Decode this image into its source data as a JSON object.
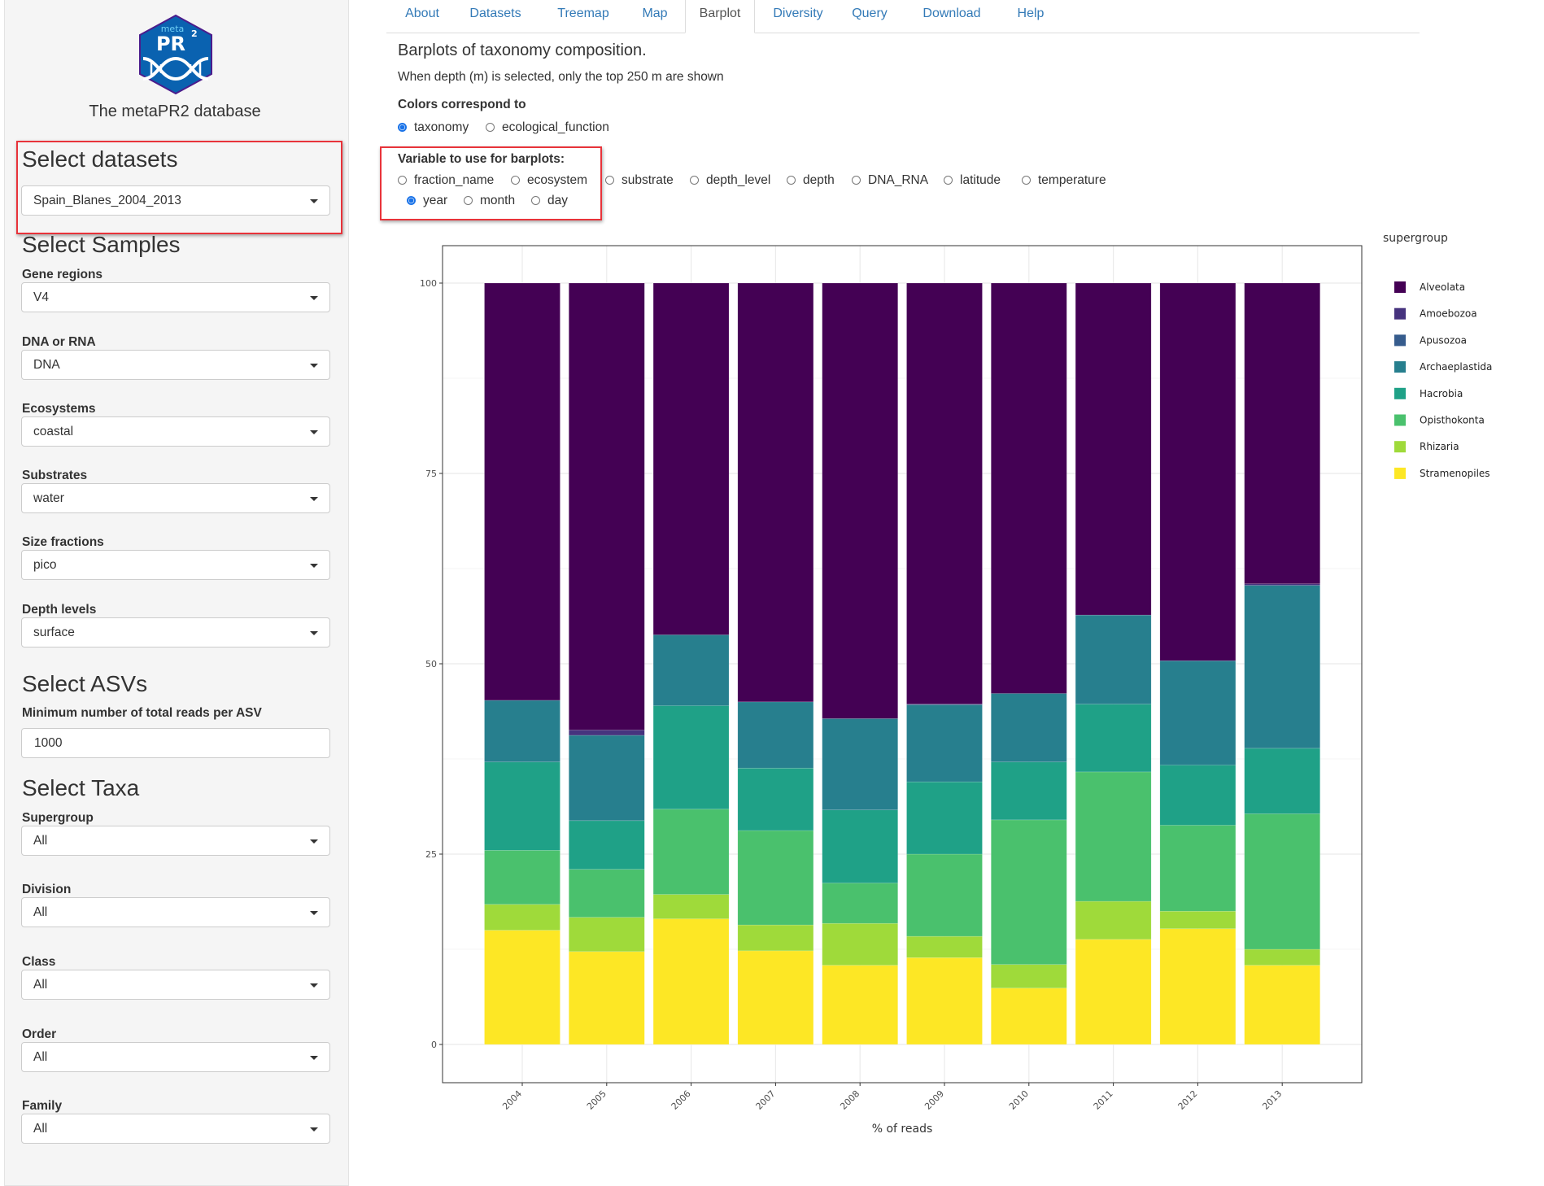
{
  "sidebar": {
    "logo": {
      "top_text": "meta",
      "main_text": "PR",
      "superscript": "2",
      "colors": {
        "fill": "#0A62B0",
        "border": "#4B1C8C",
        "text_top": "#6FD0F5"
      }
    },
    "app_title": "The metaPR2 database",
    "datasets": {
      "heading": "Select datasets",
      "value": "Spain_Blanes_2004_2013"
    },
    "samples": {
      "heading": "Select Samples",
      "fields": [
        {
          "label": "Gene regions",
          "value": "V4"
        },
        {
          "label": "DNA or RNA",
          "value": "DNA"
        },
        {
          "label": "Ecosystems",
          "value": "coastal"
        },
        {
          "label": "Substrates",
          "value": "water"
        },
        {
          "label": "Size fractions",
          "value": "pico"
        },
        {
          "label": "Depth levels",
          "value": "surface"
        }
      ]
    },
    "asvs": {
      "heading": "Select ASVs",
      "label": "Minimum number of total reads per ASV",
      "value": "1000"
    },
    "taxa": {
      "heading": "Select Taxa",
      "fields": [
        {
          "label": "Supergroup",
          "value": "All"
        },
        {
          "label": "Division",
          "value": "All"
        },
        {
          "label": "Class",
          "value": "All"
        },
        {
          "label": "Order",
          "value": "All"
        },
        {
          "label": "Family",
          "value": "All"
        }
      ]
    }
  },
  "tabs": [
    {
      "label": "About",
      "active": false
    },
    {
      "label": "Datasets",
      "active": false
    },
    {
      "label": "Treemap",
      "active": false
    },
    {
      "label": "Map",
      "active": false
    },
    {
      "label": "Barplot",
      "active": true
    },
    {
      "label": "Diversity",
      "active": false
    },
    {
      "label": "Query",
      "active": false
    },
    {
      "label": "Download",
      "active": false
    },
    {
      "label": "Help",
      "active": false
    }
  ],
  "main": {
    "title": "Barplots of taxonomy composition.",
    "note": "When depth (m) is selected, only the top 250 m are shown",
    "colors_label": "Colors correspond to",
    "colors_options": [
      {
        "label": "taxonomy",
        "selected": true
      },
      {
        "label": "ecological_function",
        "selected": false
      }
    ],
    "variable_label": "Variable to use for barplots:",
    "variable_options": [
      {
        "label": "fraction_name",
        "selected": false
      },
      {
        "label": "ecosystem",
        "selected": false
      },
      {
        "label": "substrate",
        "selected": false
      },
      {
        "label": "depth_level",
        "selected": false
      },
      {
        "label": "depth",
        "selected": false
      },
      {
        "label": "DNA_RNA",
        "selected": false
      },
      {
        "label": "latitude",
        "selected": false
      },
      {
        "label": "temperature",
        "selected": false
      },
      {
        "label": "year",
        "selected": true
      },
      {
        "label": "month",
        "selected": false
      },
      {
        "label": "day",
        "selected": false
      }
    ],
    "highlight_color": "#E8333A"
  },
  "chart_data": {
    "type": "bar",
    "stacked": true,
    "categories": [
      "2004",
      "2005",
      "2006",
      "2007",
      "2008",
      "2009",
      "2010",
      "2011",
      "2012",
      "2013"
    ],
    "xlabel": "% of reads",
    "ylabel": "",
    "ylim": [
      0,
      100
    ],
    "yticks": [
      0,
      25,
      50,
      75,
      100
    ],
    "grid": true,
    "legend_title": "supergroup",
    "legend_position": "right",
    "series": [
      {
        "name": "Alveolata",
        "color": "#440154",
        "values": [
          54.8,
          58.7,
          46.2,
          55.0,
          57.2,
          55.3,
          53.9,
          43.6,
          49.6,
          39.5
        ]
      },
      {
        "name": "Amoebozoa",
        "color": "#46337E",
        "values": [
          0,
          0.7,
          0,
          0,
          0,
          0,
          0,
          0,
          0,
          0.2
        ]
      },
      {
        "name": "Apusozoa",
        "color": "#365C8D",
        "values": [
          0,
          0,
          0,
          0,
          0,
          0.1,
          0,
          0,
          0,
          0
        ]
      },
      {
        "name": "Archaeplastida",
        "color": "#277F8E",
        "values": [
          8.1,
          11.2,
          9.3,
          8.7,
          12.0,
          10.1,
          9.0,
          11.7,
          13.7,
          21.4
        ]
      },
      {
        "name": "Hacrobia",
        "color": "#1FA187",
        "values": [
          11.6,
          6.4,
          13.6,
          8.2,
          9.6,
          9.5,
          7.6,
          8.9,
          7.9,
          8.6
        ]
      },
      {
        "name": "Opisthokonta",
        "color": "#4AC16D",
        "values": [
          7.1,
          6.3,
          11.2,
          12.4,
          5.3,
          10.8,
          19.0,
          17.0,
          11.3,
          17.8
        ]
      },
      {
        "name": "Rhizaria",
        "color": "#9FDA3A",
        "values": [
          3.4,
          4.5,
          3.2,
          3.4,
          5.5,
          2.8,
          3.1,
          5.0,
          2.3,
          2.1
        ]
      },
      {
        "name": "Stramenopiles",
        "color": "#FDE725",
        "values": [
          15.0,
          12.2,
          16.5,
          12.3,
          10.4,
          11.4,
          7.4,
          13.8,
          15.2,
          10.4
        ]
      }
    ]
  }
}
